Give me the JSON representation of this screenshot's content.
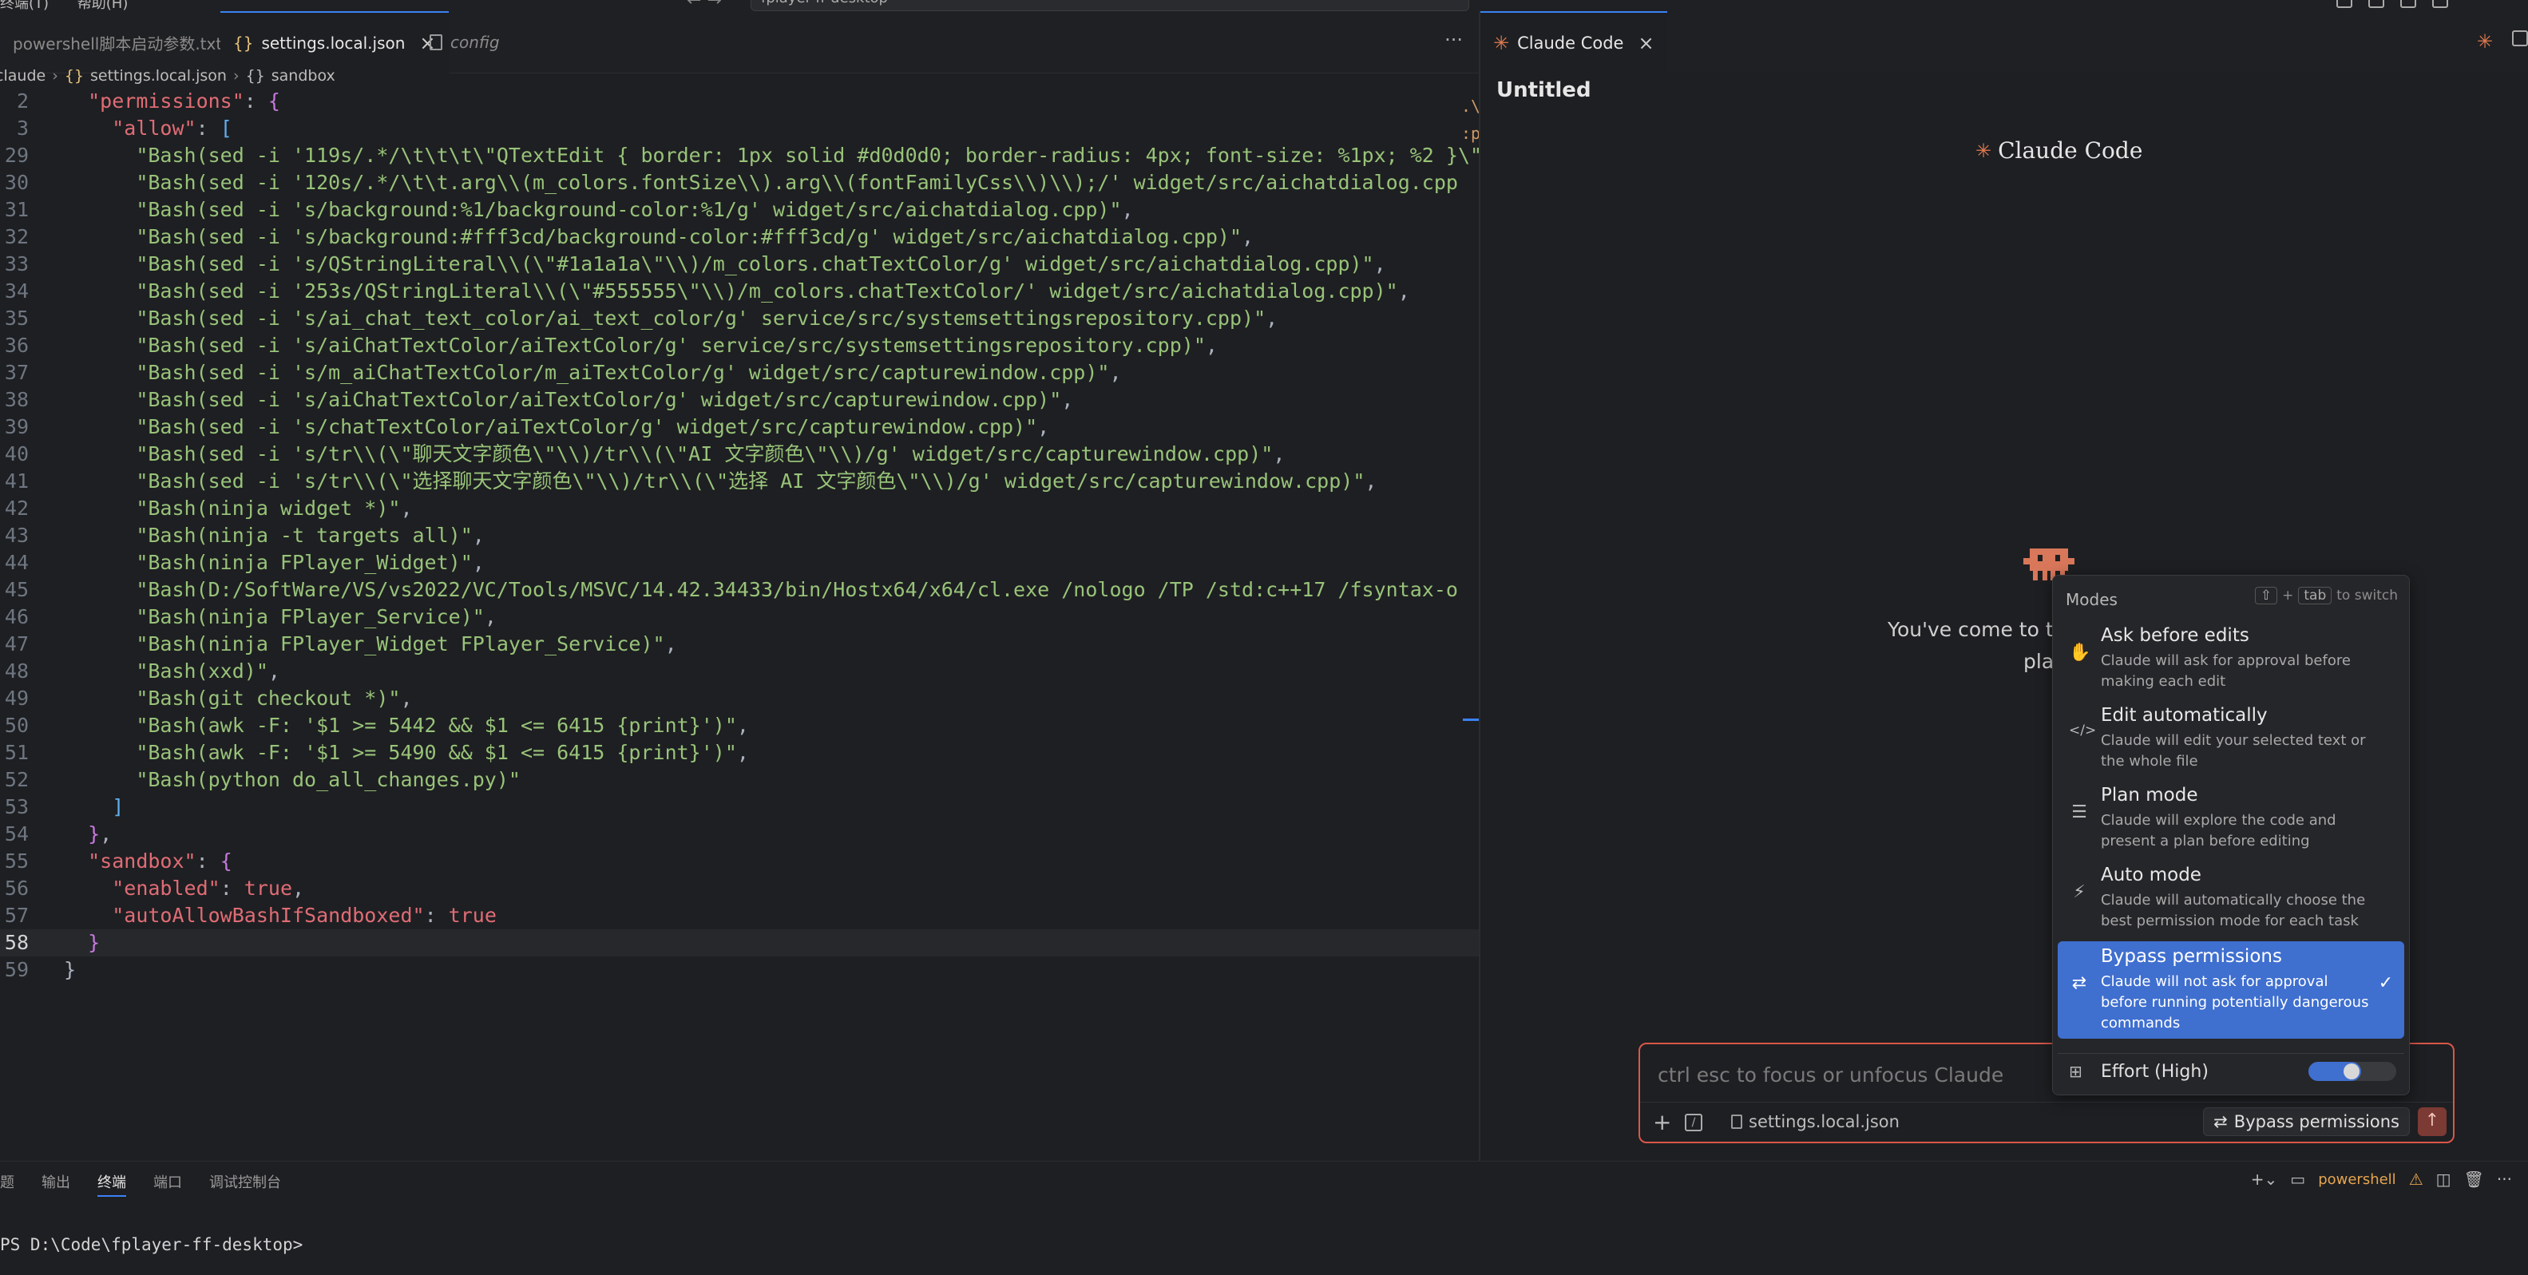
{
  "titlebar": {
    "menus": [
      "终端(T)",
      "帮助(H)"
    ],
    "search_text": "fplayer-ff-desktop"
  },
  "editor_tabs": [
    {
      "label": "powershell脚本启动参数.txt",
      "active": false
    },
    {
      "label": "settings.local.json",
      "active": true
    },
    {
      "label": "config",
      "active": false
    }
  ],
  "breadcrumb": [
    ".claude",
    "settings.local.json",
    "sandbox"
  ],
  "code_lines": [
    {
      "n": "2",
      "html": "  <span class='k'>\"permissions\"</span><span class='p'>: </span><span class='b1'>{</span>"
    },
    {
      "n": "3",
      "html": "    <span class='k'>\"allow\"</span><span class='p'>: </span><span class='b2'>[</span>"
    },
    {
      "n": "29",
      "html": "      <span class='s'>\"Bash(sed -i '119s/.*/\\t\\t\\t\\\"QTextEdit { border: 1px solid #d0d0d0; border-radius: 4px; font-size: %1px; %2 }\\\"</span>"
    },
    {
      "n": "30",
      "html": "      <span class='s'>\"Bash(sed -i '120s/.*/\\t\\t.arg\\\\(m_colors.fontSize\\\\).arg\\\\(fontFamilyCss\\\\)\\\\);/' widget/src/aichatdialog.cpp</span>"
    },
    {
      "n": "31",
      "html": "      <span class='s'>\"Bash(sed -i 's/background:%1/background-color:%1/g' widget/src/aichatdialog.cpp)\"</span><span class='p'>,</span>"
    },
    {
      "n": "32",
      "html": "      <span class='s'>\"Bash(sed -i 's/background:#fff3cd/background-color:#fff3cd/g' widget/src/aichatdialog.cpp)\"</span><span class='p'>,</span>"
    },
    {
      "n": "33",
      "html": "      <span class='s'>\"Bash(sed -i 's/QStringLiteral\\\\(\\\"#1a1a1a\\\"\\\\)/m_colors.chatTextColor/g' widget/src/aichatdialog.cpp)\"</span><span class='p'>,</span>"
    },
    {
      "n": "34",
      "html": "      <span class='s'>\"Bash(sed -i '253s/QStringLiteral\\\\(\\\"#555555\\\"\\\\)/m_colors.chatTextColor/' widget/src/aichatdialog.cpp)\"</span><span class='p'>,</span>"
    },
    {
      "n": "35",
      "html": "      <span class='s'>\"Bash(sed -i 's/ai_chat_text_color/ai_text_color/g' service/src/systemsettingsrepository.cpp)\"</span><span class='p'>,</span>"
    },
    {
      "n": "36",
      "html": "      <span class='s'>\"Bash(sed -i 's/aiChatTextColor/aiTextColor/g' service/src/systemsettingsrepository.cpp)\"</span><span class='p'>,</span>"
    },
    {
      "n": "37",
      "html": "      <span class='s'>\"Bash(sed -i 's/m_aiChatTextColor/m_aiTextColor/g' widget/src/capturewindow.cpp)\"</span><span class='p'>,</span>"
    },
    {
      "n": "38",
      "html": "      <span class='s'>\"Bash(sed -i 's/aiChatTextColor/aiTextColor/g' widget/src/capturewindow.cpp)\"</span><span class='p'>,</span>"
    },
    {
      "n": "39",
      "html": "      <span class='s'>\"Bash(sed -i 's/chatTextColor/aiTextColor/g' widget/src/capturewindow.cpp)\"</span><span class='p'>,</span>"
    },
    {
      "n": "40",
      "html": "      <span class='s'>\"Bash(sed -i 's/tr\\\\(\\\"聊天文字颜色\\\"\\\\)/tr\\\\(\\\"AI 文字颜色\\\"\\\\)/g' widget/src/capturewindow.cpp)\"</span><span class='p'>,</span>"
    },
    {
      "n": "41",
      "html": "      <span class='s'>\"Bash(sed -i 's/tr\\\\(\\\"选择聊天文字颜色\\\"\\\\)/tr\\\\(\\\"选择 AI 文字颜色\\\"\\\\)/g' widget/src/capturewindow.cpp)\"</span><span class='p'>,</span>"
    },
    {
      "n": "42",
      "html": "      <span class='s'>\"Bash(ninja widget *)\"</span><span class='p'>,</span>"
    },
    {
      "n": "43",
      "html": "      <span class='s'>\"Bash(ninja -t targets all)\"</span><span class='p'>,</span>"
    },
    {
      "n": "44",
      "html": "      <span class='s'>\"Bash(ninja FPlayer_Widget)\"</span><span class='p'>,</span>"
    },
    {
      "n": "45",
      "html": "      <span class='s'>\"Bash(D:/SoftWare/VS/vs2022/VC/Tools/MSVC/14.42.34433/bin/Hostx64/x64/cl.exe /nologo /TP /std:c++17 /fsyntax-o</span>"
    },
    {
      "n": "46",
      "html": "      <span class='s'>\"Bash(ninja FPlayer_Service)\"</span><span class='p'>,</span>"
    },
    {
      "n": "47",
      "html": "      <span class='s'>\"Bash(ninja FPlayer_Widget FPlayer_Service)\"</span><span class='p'>,</span>"
    },
    {
      "n": "48",
      "html": "      <span class='s'>\"Bash(xxd)\"</span><span class='p'>,</span>"
    },
    {
      "n": "49",
      "html": "      <span class='s'>\"Bash(git checkout *)\"</span><span class='p'>,</span>"
    },
    {
      "n": "50",
      "html": "      <span class='s'>\"Bash(awk -F: '$1 >= 5442 &amp;&amp; $1 &lt;= 6415 {print}')\"</span><span class='p'>,</span>"
    },
    {
      "n": "51",
      "html": "      <span class='s'>\"Bash(awk -F: '$1 >= 5490 &amp;&amp; $1 &lt;= 6415 {print}')\"</span><span class='p'>,</span>"
    },
    {
      "n": "52",
      "html": "      <span class='s'>\"Bash(python do_all_changes.py)\"</span>"
    },
    {
      "n": "53",
      "html": "    <span class='b2'>]</span>"
    },
    {
      "n": "54",
      "html": "  <span class='b1'>}</span><span class='p'>,</span>"
    },
    {
      "n": "55",
      "html": "  <span class='k'>\"sandbox\"</span><span class='p'>: </span><span class='b1'>{</span>"
    },
    {
      "n": "56",
      "html": "    <span class='k'>\"enabled\"</span><span class='p'>: </span><span class='t'>true</span><span class='p'>,</span>"
    },
    {
      "n": "57",
      "html": "    <span class='k'>\"autoAllowBashIfSandboxed\"</span><span class='p'>: </span><span class='t'>true</span>"
    },
    {
      "n": "58",
      "html": "  <span class='b1'>}</span>",
      "current": true
    },
    {
      "n": "59",
      "html": "<span class='p'>}</span>"
    }
  ],
  "minimap_marks": ".\\\n:p",
  "right_panel": {
    "tab_label": "Claude Code",
    "session_title": "Untitled",
    "logo_text": "Claude Code",
    "welcome_line1": "You've come to th",
    "welcome_line2": "plac"
  },
  "modes_popup": {
    "header": "Modes",
    "hint_key1": "⇧",
    "hint_plus": "+",
    "hint_key2": "tab",
    "hint_text": "to switch",
    "items": [
      {
        "title": "Ask before edits",
        "desc": "Claude will ask for approval before making each edit",
        "icon": "✋",
        "selected": false
      },
      {
        "title": "Edit automatically",
        "desc": "Claude will edit your selected text or the whole file",
        "icon": "</>",
        "selected": false
      },
      {
        "title": "Plan mode",
        "desc": "Claude will explore the code and present a plan before editing",
        "icon": "☰",
        "selected": false
      },
      {
        "title": "Auto mode",
        "desc": "Claude will automatically choose the best permission mode for each task",
        "icon": "⚡",
        "selected": false
      },
      {
        "title": "Bypass permissions",
        "desc": "Claude will not ask for approval before running potentially dangerous commands",
        "icon": "⇄",
        "selected": true
      }
    ],
    "check": "✓",
    "effort_label": "Effort (High)",
    "effort_level": 0.6
  },
  "chat": {
    "placeholder": "ctrl esc to focus or unfocus Claude",
    "context_file": "settings.local.json",
    "mode_button": "Bypass permissions"
  },
  "bottom_panel": {
    "tabs": [
      "问题",
      "输出",
      "终端",
      "端口",
      "调试控制台"
    ],
    "active_tab": "终端",
    "terminal_name": "powershell",
    "prompt": "PS D:\\Code\\fplayer-ff-desktop>"
  }
}
